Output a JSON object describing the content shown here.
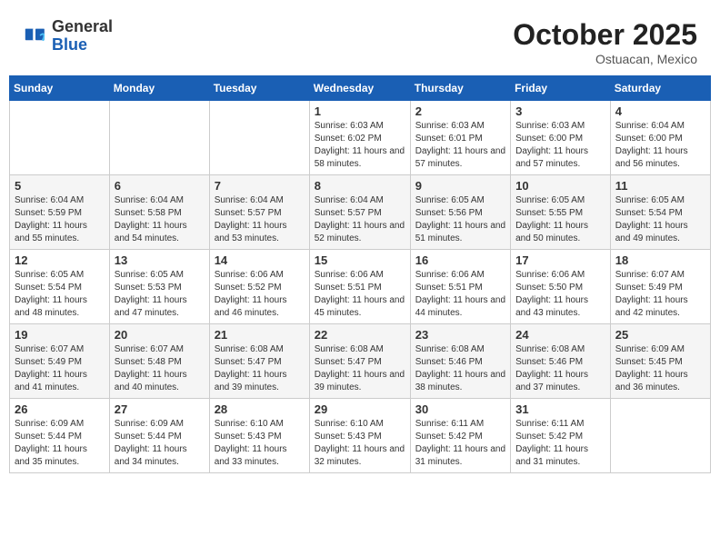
{
  "header": {
    "logo_general": "General",
    "logo_blue": "Blue",
    "month_title": "October 2025",
    "subtitle": "Ostuacan, Mexico"
  },
  "days_of_week": [
    "Sunday",
    "Monday",
    "Tuesday",
    "Wednesday",
    "Thursday",
    "Friday",
    "Saturday"
  ],
  "weeks": [
    [
      {
        "day": null,
        "info": null
      },
      {
        "day": null,
        "info": null
      },
      {
        "day": null,
        "info": null
      },
      {
        "day": "1",
        "info": "Sunrise: 6:03 AM\nSunset: 6:02 PM\nDaylight: 11 hours and 58 minutes."
      },
      {
        "day": "2",
        "info": "Sunrise: 6:03 AM\nSunset: 6:01 PM\nDaylight: 11 hours and 57 minutes."
      },
      {
        "day": "3",
        "info": "Sunrise: 6:03 AM\nSunset: 6:00 PM\nDaylight: 11 hours and 57 minutes."
      },
      {
        "day": "4",
        "info": "Sunrise: 6:04 AM\nSunset: 6:00 PM\nDaylight: 11 hours and 56 minutes."
      }
    ],
    [
      {
        "day": "5",
        "info": "Sunrise: 6:04 AM\nSunset: 5:59 PM\nDaylight: 11 hours and 55 minutes."
      },
      {
        "day": "6",
        "info": "Sunrise: 6:04 AM\nSunset: 5:58 PM\nDaylight: 11 hours and 54 minutes."
      },
      {
        "day": "7",
        "info": "Sunrise: 6:04 AM\nSunset: 5:57 PM\nDaylight: 11 hours and 53 minutes."
      },
      {
        "day": "8",
        "info": "Sunrise: 6:04 AM\nSunset: 5:57 PM\nDaylight: 11 hours and 52 minutes."
      },
      {
        "day": "9",
        "info": "Sunrise: 6:05 AM\nSunset: 5:56 PM\nDaylight: 11 hours and 51 minutes."
      },
      {
        "day": "10",
        "info": "Sunrise: 6:05 AM\nSunset: 5:55 PM\nDaylight: 11 hours and 50 minutes."
      },
      {
        "day": "11",
        "info": "Sunrise: 6:05 AM\nSunset: 5:54 PM\nDaylight: 11 hours and 49 minutes."
      }
    ],
    [
      {
        "day": "12",
        "info": "Sunrise: 6:05 AM\nSunset: 5:54 PM\nDaylight: 11 hours and 48 minutes."
      },
      {
        "day": "13",
        "info": "Sunrise: 6:05 AM\nSunset: 5:53 PM\nDaylight: 11 hours and 47 minutes."
      },
      {
        "day": "14",
        "info": "Sunrise: 6:06 AM\nSunset: 5:52 PM\nDaylight: 11 hours and 46 minutes."
      },
      {
        "day": "15",
        "info": "Sunrise: 6:06 AM\nSunset: 5:51 PM\nDaylight: 11 hours and 45 minutes."
      },
      {
        "day": "16",
        "info": "Sunrise: 6:06 AM\nSunset: 5:51 PM\nDaylight: 11 hours and 44 minutes."
      },
      {
        "day": "17",
        "info": "Sunrise: 6:06 AM\nSunset: 5:50 PM\nDaylight: 11 hours and 43 minutes."
      },
      {
        "day": "18",
        "info": "Sunrise: 6:07 AM\nSunset: 5:49 PM\nDaylight: 11 hours and 42 minutes."
      }
    ],
    [
      {
        "day": "19",
        "info": "Sunrise: 6:07 AM\nSunset: 5:49 PM\nDaylight: 11 hours and 41 minutes."
      },
      {
        "day": "20",
        "info": "Sunrise: 6:07 AM\nSunset: 5:48 PM\nDaylight: 11 hours and 40 minutes."
      },
      {
        "day": "21",
        "info": "Sunrise: 6:08 AM\nSunset: 5:47 PM\nDaylight: 11 hours and 39 minutes."
      },
      {
        "day": "22",
        "info": "Sunrise: 6:08 AM\nSunset: 5:47 PM\nDaylight: 11 hours and 39 minutes."
      },
      {
        "day": "23",
        "info": "Sunrise: 6:08 AM\nSunset: 5:46 PM\nDaylight: 11 hours and 38 minutes."
      },
      {
        "day": "24",
        "info": "Sunrise: 6:08 AM\nSunset: 5:46 PM\nDaylight: 11 hours and 37 minutes."
      },
      {
        "day": "25",
        "info": "Sunrise: 6:09 AM\nSunset: 5:45 PM\nDaylight: 11 hours and 36 minutes."
      }
    ],
    [
      {
        "day": "26",
        "info": "Sunrise: 6:09 AM\nSunset: 5:44 PM\nDaylight: 11 hours and 35 minutes."
      },
      {
        "day": "27",
        "info": "Sunrise: 6:09 AM\nSunset: 5:44 PM\nDaylight: 11 hours and 34 minutes."
      },
      {
        "day": "28",
        "info": "Sunrise: 6:10 AM\nSunset: 5:43 PM\nDaylight: 11 hours and 33 minutes."
      },
      {
        "day": "29",
        "info": "Sunrise: 6:10 AM\nSunset: 5:43 PM\nDaylight: 11 hours and 32 minutes."
      },
      {
        "day": "30",
        "info": "Sunrise: 6:11 AM\nSunset: 5:42 PM\nDaylight: 11 hours and 31 minutes."
      },
      {
        "day": "31",
        "info": "Sunrise: 6:11 AM\nSunset: 5:42 PM\nDaylight: 11 hours and 31 minutes."
      },
      {
        "day": null,
        "info": null
      }
    ]
  ]
}
